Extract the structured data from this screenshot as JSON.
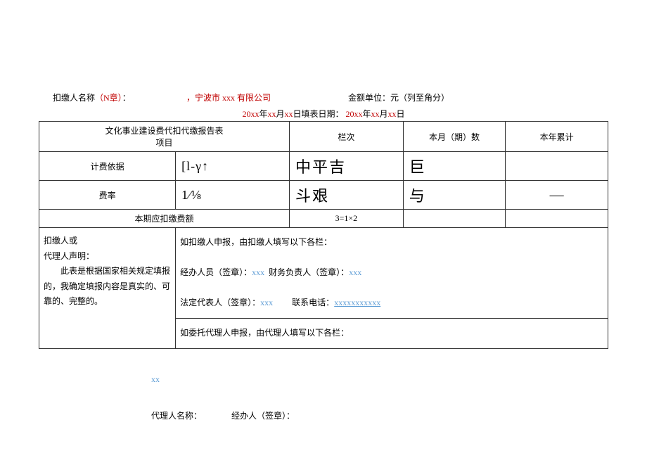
{
  "header": {
    "payer_label": "扣缴人名称",
    "payer_note": "（N章）",
    "colon": "：",
    "company": "宁波市 xxx 有限公司",
    "company_prefix": "，",
    "amount_unit_label": "金额单位：",
    "amount_unit_value": "元（列至角分）"
  },
  "date_line": {
    "yr1": "20xx",
    "yr_suffix1": "年",
    "mo1": "xx",
    "mo_suffix1": "月",
    "dy1": "xx",
    "dy_suffix1": "日填表日期：",
    "yr2": "20xx",
    "yr_suffix2": "年",
    "mo2": "xx",
    "mo_suffix2": "月",
    "dy2": "xx",
    "dy_suffix2": "日"
  },
  "table": {
    "title1": "文化事业建设费代扣代缴报告表",
    "title2": "项目",
    "col_lanci": "栏次",
    "col_month": "本月（期）数",
    "col_year": "本年累计",
    "rows": [
      {
        "label": "计费依据",
        "v1": "[l-γ↑",
        "v2": "中平吉",
        "v3": "巨",
        "v4": ""
      },
      {
        "label": "费率",
        "v1": "1⁄⅛",
        "v2": "斗艰",
        "v3": "与",
        "v4": "—"
      },
      {
        "label": "本期应扣缴费额",
        "v1": "",
        "v2": "3=1×2",
        "v3": "",
        "v4": ""
      }
    ]
  },
  "declaration": {
    "l1": "扣缴人或",
    "l2": "代理人声明：",
    "l3": "　　此表是根据国家相关规定填报的，我确定填报内容是真实的、可靠的、完整的。"
  },
  "fill_by_payer": {
    "title": "如扣缴人申报，由扣缴人填写以下各栏：",
    "line2a": "经办人员（签章）：",
    "line2a_v": "xxx",
    "line2b": "财务负责人（签章）：",
    "line2b_v": "xxx",
    "line3a": "法定代表人（签章）：",
    "line3a_v": "xxx",
    "line3b": "联系电话：",
    "line3b_v": "xxxxxxxxxxx"
  },
  "fill_by_agent": {
    "title": "如委托代理人申报，由代理人填写以下各栏："
  },
  "footer": {
    "xx": "xx",
    "agent_name_label": "代理人名称：",
    "handler_label": "经办人（签章）："
  }
}
